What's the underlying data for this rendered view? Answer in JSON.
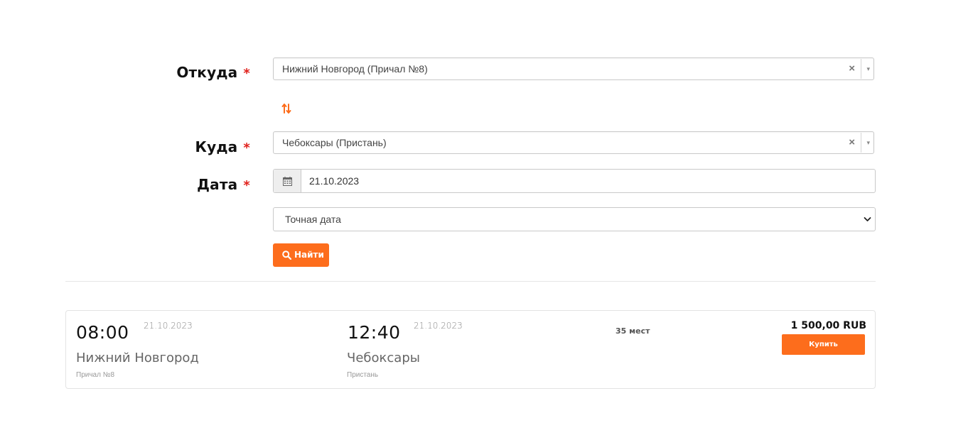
{
  "form": {
    "from": {
      "label": "Откуда",
      "required_mark": "*",
      "value": "Нижний Новгород (Причал №8)",
      "clear_glyph": "×",
      "arrow_glyph": "▾"
    },
    "swap_icon": "swap-vertical-arrows",
    "to": {
      "label": "Куда",
      "required_mark": "*",
      "value": "Чебоксары (Пристань)",
      "clear_glyph": "×",
      "arrow_glyph": "▾"
    },
    "date": {
      "label": "Дата",
      "required_mark": "*",
      "value": "21.10.2023",
      "icon": "calendar-icon"
    },
    "date_mode": {
      "selected": "Точная дата"
    },
    "search_button": {
      "label": "Найти",
      "icon": "search-icon"
    }
  },
  "results": [
    {
      "departure": {
        "time": "08:00",
        "date": "21.10.2023",
        "city": "Нижний Новгород",
        "pier": "Причал №8"
      },
      "arrival": {
        "time": "12:40",
        "date": "21.10.2023",
        "city": "Чебоксары",
        "pier": "Пристань"
      },
      "seats": "35 мест",
      "price": "1 500,00 RUB",
      "buy_label": "Купить"
    }
  ],
  "colors": {
    "accent": "#fd6d1c",
    "required": "#e0201b"
  }
}
